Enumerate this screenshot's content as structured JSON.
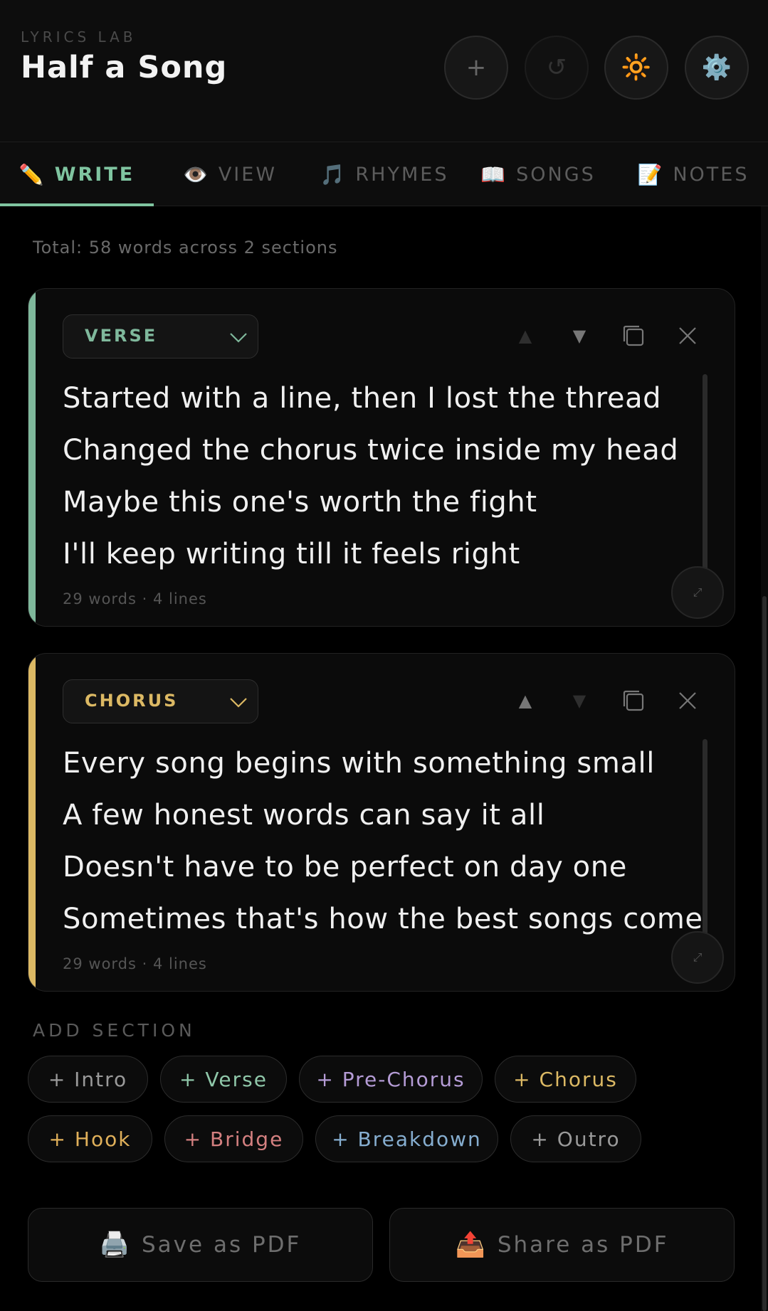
{
  "header": {
    "brand": "LYRICS LAB",
    "title": "Half a Song",
    "add_icon": "+",
    "undo_icon": "↺",
    "theme_icon": "🔆",
    "settings_icon": "⚙️"
  },
  "tabs": [
    {
      "icon": "✏️",
      "label": "WRITE",
      "active": true
    },
    {
      "icon": "👁️",
      "label": "VIEW"
    },
    {
      "icon": "🎵",
      "label": "RHYMES"
    },
    {
      "icon": "📖",
      "label": "SONGS"
    },
    {
      "icon": "📝",
      "label": "NOTES"
    }
  ],
  "summary": "Total: 58 words across 2 sections",
  "sections": [
    {
      "type": "VERSE",
      "accent": "#7fb89c",
      "lines": [
        "Started with a line, then I lost the thread",
        "Changed the chorus twice inside my head",
        "Maybe this one's worth the fight",
        "I'll keep writing till it feels right"
      ],
      "meta": "29 words · 4 lines"
    },
    {
      "type": "CHORUS",
      "accent": "#dcb964",
      "lines": [
        "Every song begins with something small",
        "A few honest words can say it all",
        "Doesn't have to be perfect on day one",
        "Sometimes that's how the best songs come"
      ],
      "meta": "29 words · 4 lines"
    }
  ],
  "add_section": {
    "title": "ADD SECTION",
    "options": [
      {
        "label": "+ Intro",
        "color": "#9a9a9a"
      },
      {
        "label": "+ Verse",
        "color": "#8fc7a9"
      },
      {
        "label": "+ Pre-Chorus",
        "color": "#b59cd6"
      },
      {
        "label": "+ Chorus",
        "color": "#dcb964"
      },
      {
        "label": "+ Hook",
        "color": "#e0b05a"
      },
      {
        "label": "+ Bridge",
        "color": "#d48080"
      },
      {
        "label": "+ Breakdown",
        "color": "#86aed0"
      },
      {
        "label": "+ Outro",
        "color": "#9a9a9a"
      }
    ]
  },
  "actions": {
    "save_icon": "🖨️",
    "save_label": "Save as PDF",
    "share_icon": "📤",
    "share_label": "Share as PDF"
  }
}
